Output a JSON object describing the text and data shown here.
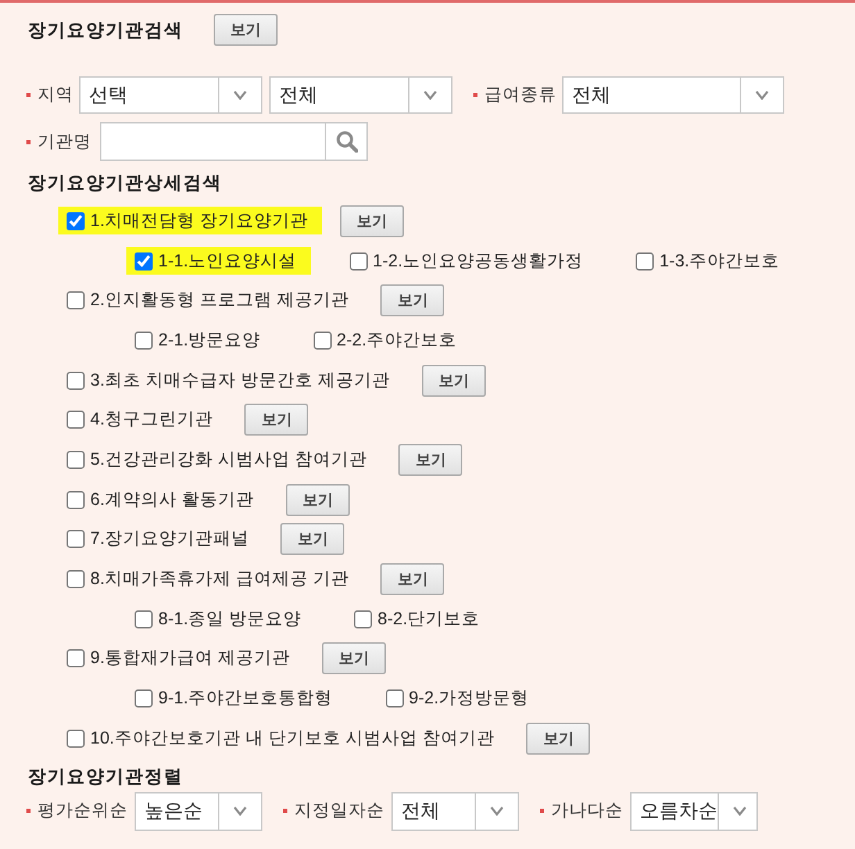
{
  "search_section": {
    "title": "장기요양기관검색",
    "button": "보기"
  },
  "filters": [
    {
      "label": "지역",
      "dropdowns": [
        "선택",
        "전체"
      ]
    },
    {
      "label": "급여종류",
      "dropdowns": [
        "전체"
      ]
    }
  ],
  "name_search": {
    "label": "기관명"
  },
  "detail": {
    "title": "장기요양기관상세검색",
    "items": [
      {
        "label": "1.치매전담형 장기요양기관",
        "checked": true,
        "highlighted": true,
        "button": "보기",
        "children": [
          {
            "label": "1-1.노인요양시설",
            "checked": true,
            "highlighted": true
          },
          {
            "label": "1-2.노인요양공동생활가정",
            "checked": false,
            "highlighted": false
          },
          {
            "label": "1-3.주야간보호",
            "checked": false,
            "highlighted": false
          }
        ]
      },
      {
        "label": "2.인지활동형 프로그램 제공기관",
        "checked": false,
        "highlighted": false,
        "button": "보기",
        "children": [
          {
            "label": "2-1.방문요양",
            "checked": false,
            "highlighted": false
          },
          {
            "label": "2-2.주야간보호",
            "checked": false,
            "highlighted": false
          }
        ]
      },
      {
        "label": "3.최초 치매수급자 방문간호 제공기관",
        "checked": false,
        "highlighted": false,
        "button": "보기"
      },
      {
        "label": "4.청구그린기관",
        "checked": false,
        "highlighted": false,
        "button": "보기"
      },
      {
        "label": "5.건강관리강화 시범사업 참여기관",
        "checked": false,
        "highlighted": false,
        "button": "보기"
      },
      {
        "label": "6.계약의사 활동기관",
        "checked": false,
        "highlighted": false,
        "button": "보기"
      },
      {
        "label": "7.장기요양기관패널",
        "checked": false,
        "highlighted": false,
        "button": "보기"
      },
      {
        "label": "8.치매가족휴가제 급여제공 기관",
        "checked": false,
        "highlighted": false,
        "button": "보기",
        "children": [
          {
            "label": "8-1.종일 방문요양",
            "checked": false,
            "highlighted": false
          },
          {
            "label": "8-2.단기보호",
            "checked": false,
            "highlighted": false
          }
        ]
      },
      {
        "label": "9.통합재가급여 제공기관",
        "checked": false,
        "highlighted": false,
        "button": "보기",
        "children": [
          {
            "label": "9-1.주야간보호통합형",
            "checked": false,
            "highlighted": false
          },
          {
            "label": "9-2.가정방문형",
            "checked": false,
            "highlighted": false
          }
        ]
      },
      {
        "label": "10.주야간보호기관 내 단기보호 시범사업 참여기관",
        "checked": false,
        "highlighted": false,
        "button": "보기"
      }
    ]
  },
  "sort_section": {
    "title": "장기요양기관정렬",
    "sorts": [
      {
        "label": "평가순위순",
        "value": "높은순"
      },
      {
        "label": "지정일자순",
        "value": "전체"
      },
      {
        "label": "가나다순",
        "value": "오름차순"
      }
    ]
  }
}
